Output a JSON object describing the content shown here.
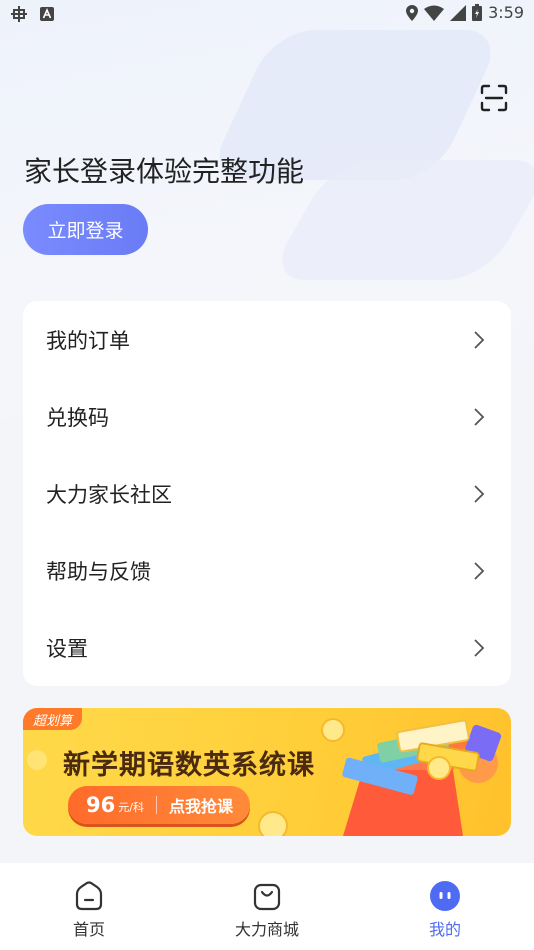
{
  "status_bar": {
    "time": "3:59"
  },
  "header": {
    "title": "家长登录体验完整功能",
    "login_button": "立即登录"
  },
  "menu": {
    "items": [
      {
        "label": "我的订单"
      },
      {
        "label": "兑换码"
      },
      {
        "label": "大力家长社区"
      },
      {
        "label": "帮助与反馈"
      },
      {
        "label": "设置"
      }
    ]
  },
  "banner": {
    "tag": "超划算",
    "title": "新学期语数英系统课",
    "price": "96",
    "price_unit": "元/科",
    "cta": "点我抢课"
  },
  "tabbar": {
    "tabs": [
      {
        "label": "首页"
      },
      {
        "label": "大力商城"
      },
      {
        "label": "我的"
      }
    ],
    "active_color": "#4f6bf4"
  }
}
